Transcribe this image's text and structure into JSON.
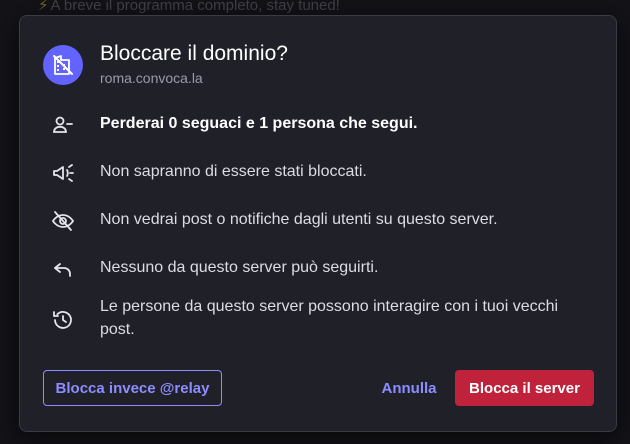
{
  "background": {
    "notice_text": "A breve il programma completo, stay tuned!"
  },
  "dialog": {
    "icon": "domain-blocked-icon",
    "title": "Bloccare il dominio?",
    "domain": "roma.convoca.la",
    "items": [
      {
        "icon": "person-remove-icon",
        "text": "Perderai 0 seguaci e 1 persona che segui.",
        "bold": true
      },
      {
        "icon": "megaphone-off-icon",
        "text": "Non sapranno di essere stati bloccati."
      },
      {
        "icon": "eye-off-icon",
        "text": "Non vedrai post o notifiche dagli utenti su questo server."
      },
      {
        "icon": "reply-icon",
        "text": "Nessuno da questo server può seguirti."
      },
      {
        "icon": "history-icon",
        "text": "Le persone da questo server possono interagire con i tuoi vecchi post."
      }
    ],
    "buttons": {
      "block_instead": "Blocca invece @relay",
      "cancel": "Annulla",
      "block_server": "Blocca il server"
    }
  },
  "colors": {
    "accent": "#8c8dff",
    "avatar": "#6364ff",
    "danger": "#c0213b",
    "dialog_bg": "#202029"
  }
}
